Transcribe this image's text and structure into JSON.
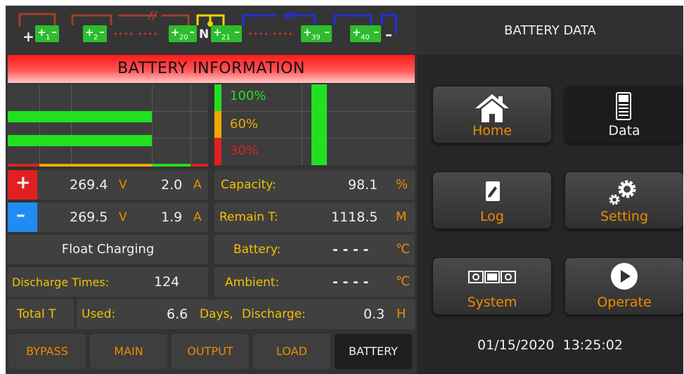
{
  "header": {
    "title": "BATTERY INFORMATION",
    "right_title": "BATTERY DATA"
  },
  "chain": {
    "plus": "+",
    "minus": "–",
    "neutral": "N",
    "battery_sign_plus": "+",
    "battery_sign_minus": "–",
    "batteries": [
      "1",
      "2",
      "20",
      "21",
      "39",
      "40"
    ],
    "dots": "•••• ••••"
  },
  "levels": {
    "high": "100%",
    "mid": "60%",
    "low": "30%",
    "bar_fill_fraction": 1.0
  },
  "readings": {
    "positive": {
      "sign": "+",
      "voltage": "269.4",
      "v_unit": "V",
      "current": "2.0",
      "a_unit": "A"
    },
    "negative": {
      "sign": "–",
      "voltage": "269.5",
      "v_unit": "V",
      "current": "1.9",
      "a_unit": "A"
    },
    "status": "Float Charging",
    "discharge_times_label": "Discharge Times:",
    "discharge_times_value": "124",
    "total_label": "Total T",
    "used_label": "Used:",
    "used_value": "6.6",
    "days_label": "Days,",
    "discharge_label": "Discharge:",
    "discharge_value": "0.3",
    "discharge_unit": "H",
    "capacity_label": "Capacity:",
    "capacity_value": "98.1",
    "capacity_unit": "%",
    "remain_label": "Remain T:",
    "remain_value": "1118.5",
    "remain_unit": "M",
    "battery_label": "Battery:",
    "battery_value": "- - - -",
    "battery_unit": "℃",
    "ambient_label": "Ambient:",
    "ambient_value": "- - - -",
    "ambient_unit": "℃"
  },
  "nav": {
    "bypass": "BYPASS",
    "main": "MAIN",
    "output": "OUTPUT",
    "load": "LOAD",
    "battery": "BATTERY"
  },
  "menu": {
    "home": "Home",
    "data": "Data",
    "log": "Log",
    "setting": "Setting",
    "system": "System",
    "operate": "Operate"
  },
  "datetime": "01/15/2020  13:25:02",
  "colors": {
    "accent_orange": "#f08a00",
    "label_yellow": "#f2c200",
    "bar_green": "#22e022",
    "title_red": "#ff1a1a"
  }
}
